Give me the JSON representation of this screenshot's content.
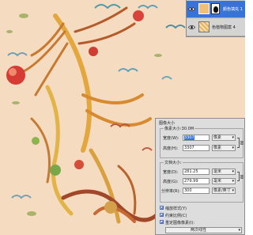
{
  "layers": {
    "items": [
      {
        "label": "颜色填充 1",
        "active": true
      },
      {
        "label": "色植物图案 4",
        "active": false
      }
    ]
  },
  "image_size_dialog": {
    "title": "图像大小",
    "pixel_dimensions": {
      "header": "像素大小:30.0M",
      "width_label": "宽度(W):",
      "width_value": "3307",
      "width_unit": "像素",
      "height_label": "高度(H):",
      "height_value": "3307",
      "height_unit": "像素"
    },
    "document_size": {
      "header": "文档大小:",
      "width_label": "宽度(D):",
      "width_value": "281.25",
      "width_unit": "毫米",
      "height_label": "高度(G):",
      "height_value": "279.99",
      "height_unit": "毫米",
      "resolution_label": "分辨率(R):",
      "resolution_value": "300",
      "resolution_unit": "像素/英寸"
    },
    "options": {
      "scale_styles": "缩放样式(Y)",
      "constrain_proportions": "约束比例(C)",
      "resample": "重定图像像素(I):",
      "resample_method": "两次线性"
    }
  },
  "colors": {
    "canvas_bg": "#f5dcc0",
    "selection_blue": "#3874d8"
  }
}
